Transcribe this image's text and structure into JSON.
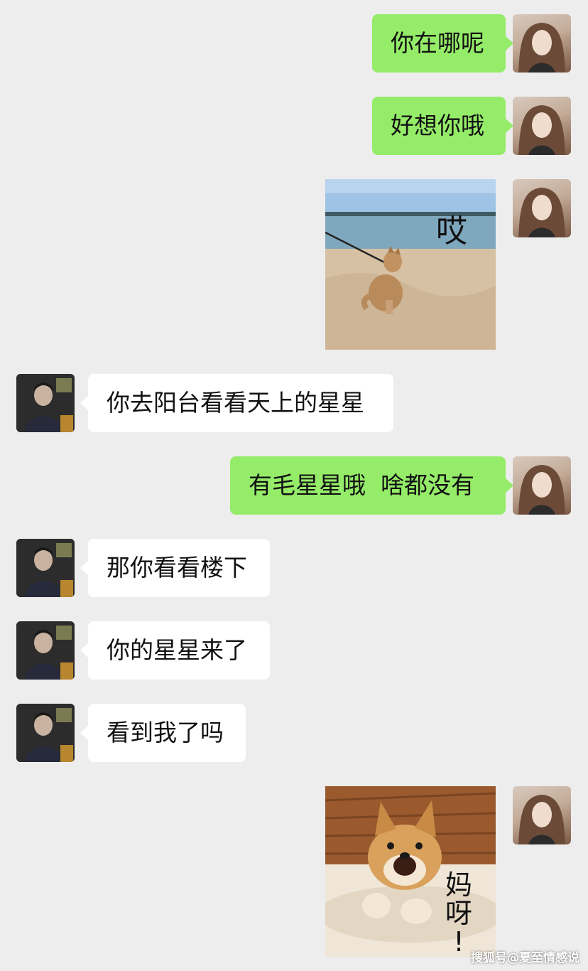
{
  "messages": [
    {
      "side": "me",
      "text": "你在哪呢"
    },
    {
      "side": "me",
      "text": "好想你哦"
    },
    {
      "side": "me",
      "type": "sticker",
      "sticker_text": "哎",
      "scene": "shiba-dog-on-beach"
    },
    {
      "side": "other",
      "text": "你去阳台看看天上的星星"
    },
    {
      "side": "me",
      "text": "有毛星星哦  啥都没有"
    },
    {
      "side": "other",
      "text": "那你看看楼下"
    },
    {
      "side": "other",
      "text": "你的星星来了"
    },
    {
      "side": "other",
      "text": "看到我了吗"
    },
    {
      "side": "me",
      "type": "sticker",
      "sticker_text": [
        "妈",
        "呀",
        "!"
      ],
      "scene": "shiba-puppy-on-wood-floor"
    }
  ],
  "watermark": "搜狐号@夏至情感说",
  "colors": {
    "background": "#ededed",
    "my_bubble": "#95ec69",
    "other_bubble": "#ffffff"
  },
  "icons": {
    "my_avatar": "avatar-woman-long-hair",
    "other_avatar": "avatar-young-man-dark"
  }
}
